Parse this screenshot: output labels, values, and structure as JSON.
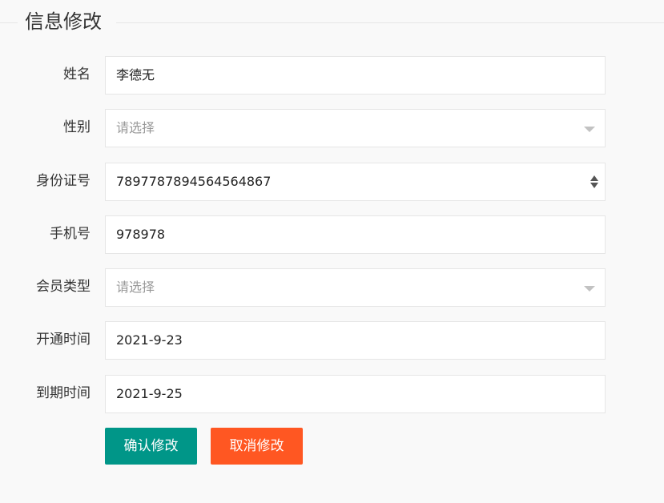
{
  "legend": "信息修改",
  "colors": {
    "confirm_button": "#009688",
    "cancel_button": "#FF5722"
  },
  "fields": {
    "name": {
      "label": "姓名",
      "value": "李德无"
    },
    "gender": {
      "label": "性别",
      "placeholder": "请选择"
    },
    "id_number": {
      "label": "身份证号",
      "value": "7897787894564564867"
    },
    "phone": {
      "label": "手机号",
      "value": "978978"
    },
    "member_type": {
      "label": "会员类型",
      "placeholder": "请选择"
    },
    "open_date": {
      "label": "开通时间",
      "value": "2021-9-23"
    },
    "expire_date": {
      "label": "到期时间",
      "value": "2021-9-25"
    }
  },
  "buttons": {
    "confirm": "确认修改",
    "cancel": "取消修改"
  },
  "icons": {
    "select_arrow": "chevron-down-icon",
    "number_spinner": "spinner-icon"
  }
}
